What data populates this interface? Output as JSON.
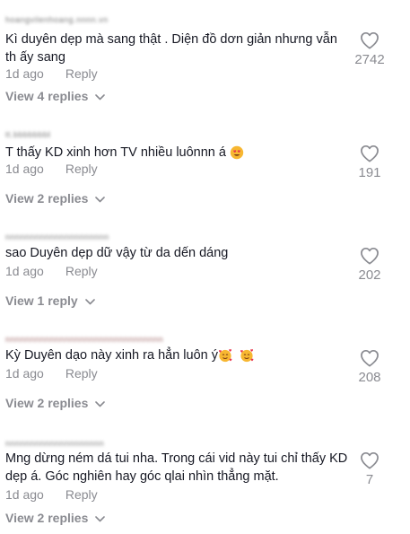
{
  "comments": [
    {
      "username": "hoangvilenhoang.nnnn.vn",
      "text": "Kì duyên dẹp mà sang thật . Diện đồ dơn giản nhưng vẫn th ấy sang",
      "time": "1d ago",
      "reply_label": "Reply",
      "view_replies": "View 4 replies",
      "likes": "2742"
    },
    {
      "username": "tt.bbbbbbbbbb",
      "text": "T thấy KD xinh hơn TV nhiều luônnn á",
      "time": "1d ago",
      "reply_label": "Reply",
      "view_replies": "View 2 replies",
      "likes": "191"
    },
    {
      "username": "nnnnnnnnnnnnnnnnnnnnn",
      "text": "sao Duyên dẹp dữ vậy từ da dến dáng",
      "time": "1d ago",
      "reply_label": "Reply",
      "view_replies": "View 1 reply",
      "likes": "202"
    },
    {
      "username": "nnnnnnnnnnnnnnnnnnnnnnnnnnnnnnnn",
      "text": "Kỳ Duyên dạo này xinh ra hẳn luôn ý",
      "time": "1d ago",
      "reply_label": "Reply",
      "view_replies": "View 2 replies",
      "likes": "208"
    },
    {
      "username": "nnnnnnnnnnnnnnnnnnnn",
      "text": "Mng dừng ném dá tui nha. Trong cái vid này tui chỉ thấy KD dẹp á. Góc nghiên hay góc qlai nhìn thẳng mặt.",
      "time": "1d ago",
      "reply_label": "Reply",
      "view_replies": "View 2 replies",
      "likes": "7"
    }
  ],
  "colors": {
    "text": "#161823",
    "muted": "#8a8b91",
    "background": "#ffffff"
  }
}
